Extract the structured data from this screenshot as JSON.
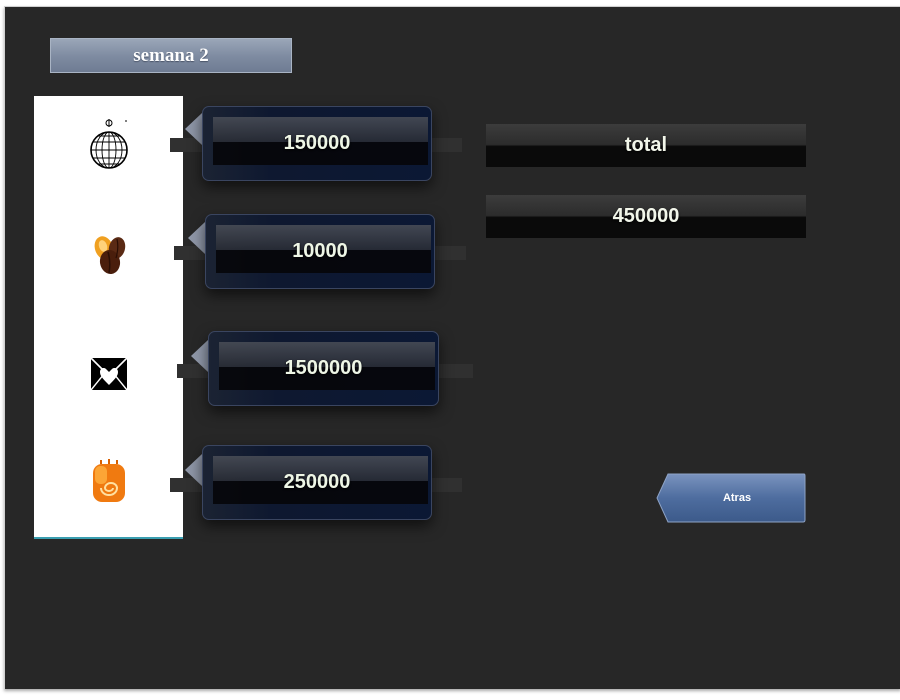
{
  "header": {
    "title": "semana 2"
  },
  "items": [
    {
      "icon": "disco-ball-icon",
      "value": "150000"
    },
    {
      "icon": "cocoa-beans-icon",
      "value": "10000"
    },
    {
      "icon": "heart-envelope-icon",
      "value": "1500000"
    },
    {
      "icon": "candy-roll-icon",
      "value": "250000"
    }
  ],
  "summary": {
    "total_label": "total",
    "total_value": "450000"
  },
  "nav": {
    "back_label": "Atras"
  },
  "colors": {
    "background": "#272727",
    "title_bar": "#7d8aa0",
    "value_box": "#0b1834",
    "back_button": "#4a6ba0"
  }
}
